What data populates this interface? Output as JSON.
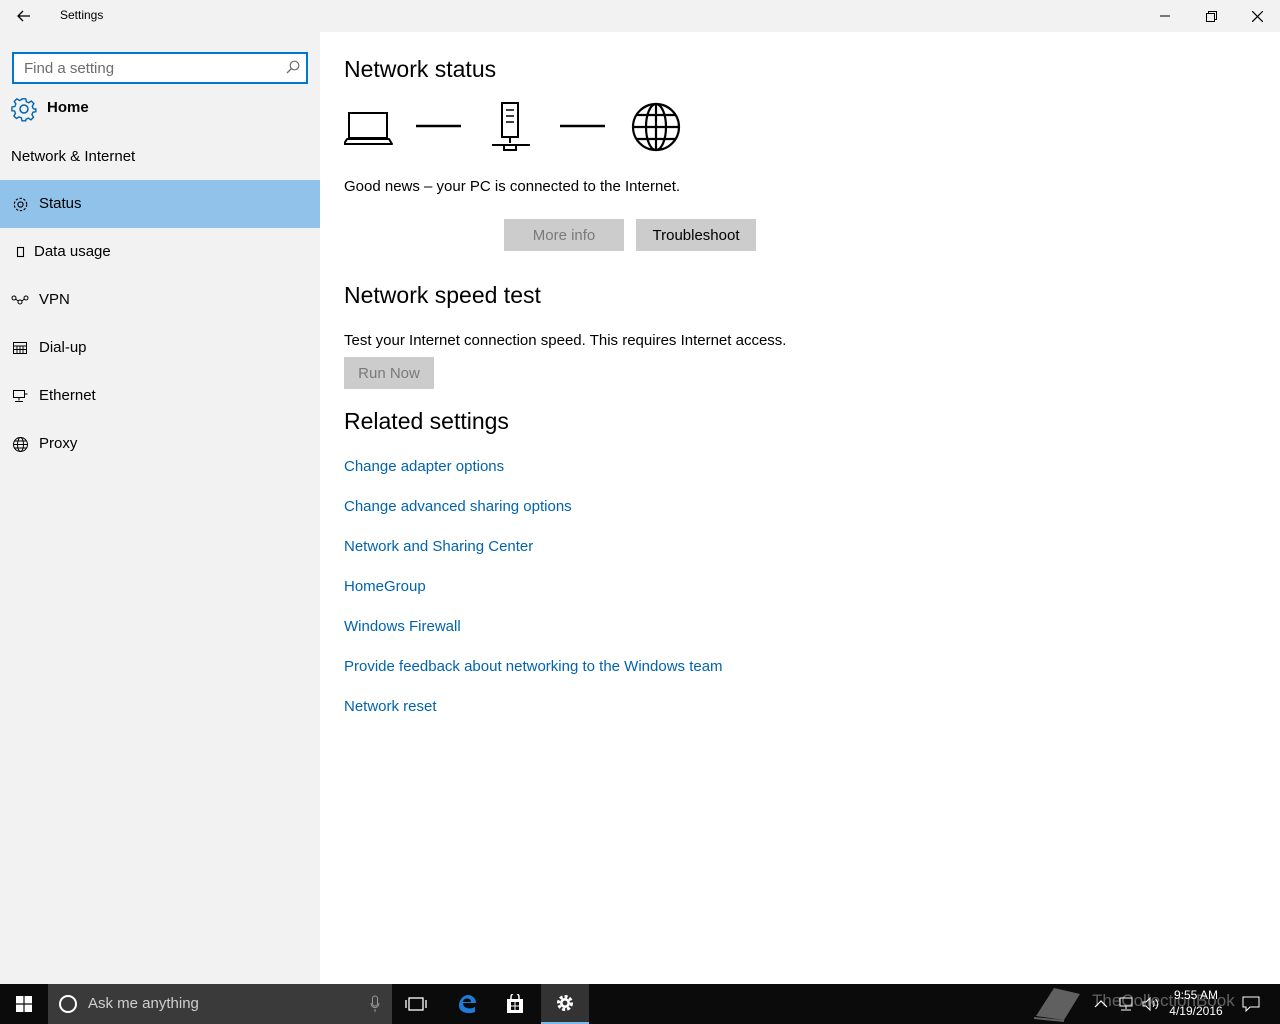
{
  "window": {
    "title": "Settings"
  },
  "sidebar": {
    "search_placeholder": "Find a setting",
    "home_label": "Home",
    "section_title": "Network & Internet",
    "items": [
      {
        "label": "Status",
        "icon": "gear-icon",
        "active": true
      },
      {
        "label": "Data usage",
        "icon": "data-usage-icon",
        "active": false
      },
      {
        "label": "VPN",
        "icon": "vpn-icon",
        "active": false
      },
      {
        "label": "Dial-up",
        "icon": "dialup-icon",
        "active": false
      },
      {
        "label": "Ethernet",
        "icon": "ethernet-icon",
        "active": false
      },
      {
        "label": "Proxy",
        "icon": "globe-icon",
        "active": false
      }
    ]
  },
  "main": {
    "network_status": {
      "heading": "Network status",
      "diagram_icons": [
        "laptop-icon",
        "router-icon",
        "globe-icon"
      ],
      "message": "Good news – your PC is connected to the Internet.",
      "more_info_label": "More info",
      "troubleshoot_label": "Troubleshoot"
    },
    "speed_test": {
      "heading": "Network speed test",
      "description": "Test your Internet connection speed. This requires Internet access.",
      "run_now_label": "Run Now"
    },
    "related": {
      "heading": "Related settings",
      "links": [
        "Change adapter options",
        "Change advanced sharing options",
        "Network and Sharing Center",
        "HomeGroup",
        "Windows Firewall",
        "Provide feedback about networking to the Windows team",
        "Network reset"
      ]
    }
  },
  "taskbar": {
    "search_placeholder": "Ask me anything",
    "clock_time": "9:55 AM",
    "clock_date": "4/19/2016",
    "watermark": "TheCollectionBook"
  },
  "colors": {
    "accent": "#0078d7",
    "link": "#0063b1",
    "nav_active": "#91c2ea",
    "sidebar_bg": "#f2f2f2",
    "taskbar_bg": "#0b0b0b"
  }
}
